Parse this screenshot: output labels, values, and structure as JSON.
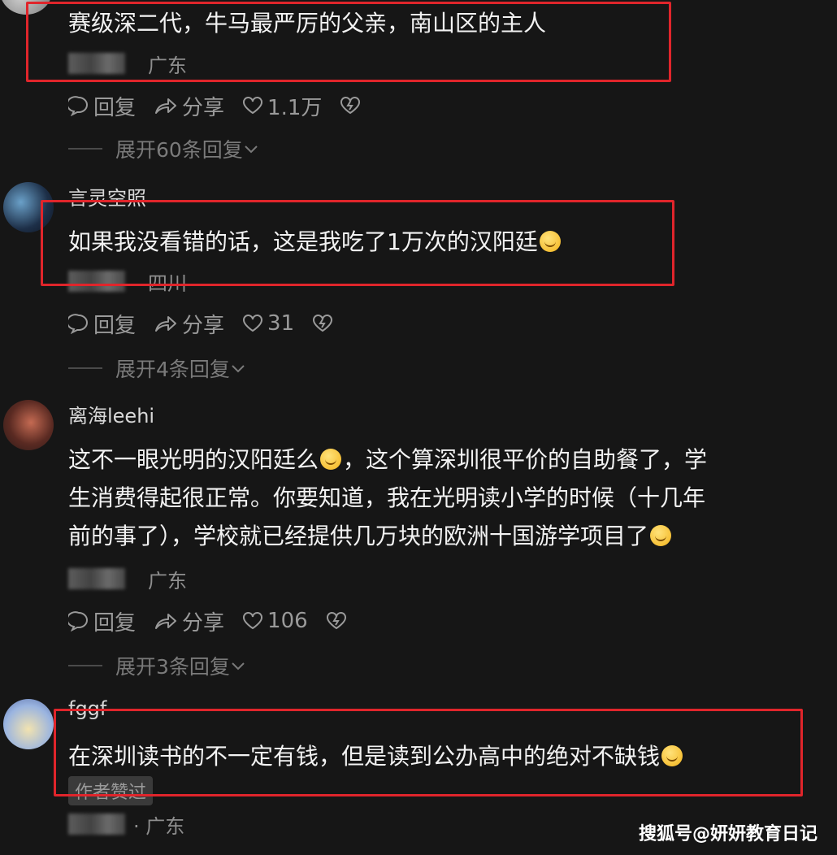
{
  "comments": [
    {
      "username": "",
      "lines": [
        "赛级深二代，牛马最严厉的父亲，南山区的主人"
      ],
      "location": "广东",
      "actions": {
        "reply": "回复",
        "share": "分享",
        "likes": "1.1万"
      },
      "expand": "展开60条回复"
    },
    {
      "username": "言灵空照",
      "lines": [
        "如果我没看错的话，这是我吃了1万次的汉阳廷"
      ],
      "location": "四川",
      "actions": {
        "reply": "回复",
        "share": "分享",
        "likes": "31"
      },
      "expand": "展开4条回复"
    },
    {
      "username": "离海leehi",
      "lines": [
        "这不一眼光明的汉阳廷么",
        "，这个算深圳很平价的自助餐了，学",
        "生消费得起很正常。你要知道，我在光明读小学的时候（十几年",
        "前的事了），学校就已经提供几万块的欧洲十国游学项目了"
      ],
      "location": "广东",
      "actions": {
        "reply": "回复",
        "share": "分享",
        "likes": "106"
      },
      "expand": "展开3条回复"
    },
    {
      "username": "fggf",
      "lines": [
        "在深圳读书的不一定有钱，但是读到公办高中的绝对不缺钱"
      ],
      "badge": "作者赞过",
      "location": "· 广东"
    }
  ],
  "watermark": "搜狐号@妍妍教育日记",
  "colors": {
    "highlight_box": "#e0252b",
    "background": "#161616"
  }
}
